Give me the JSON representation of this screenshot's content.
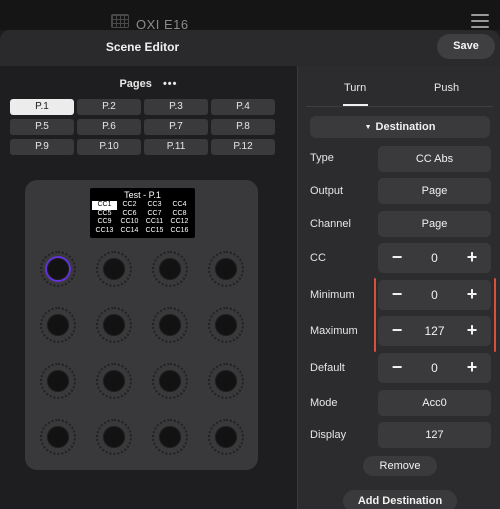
{
  "window": {
    "device_name": "OXI E16",
    "title": "Scene Editor",
    "save_label": "Save"
  },
  "pages": {
    "label": "Pages",
    "more": "•••",
    "items": [
      "P.1",
      "P.2",
      "P.3",
      "P.4",
      "P.5",
      "P.6",
      "P.7",
      "P.8",
      "P.9",
      "P.10",
      "P.11",
      "P.12"
    ],
    "selected": "P.1"
  },
  "device": {
    "screen_title": "Test - P.1",
    "cc_labels": [
      "CC1",
      "CC2",
      "CC3",
      "CC4",
      "CC5",
      "CC6",
      "CC7",
      "CC8",
      "CC9",
      "CC10",
      "CC11",
      "CC12",
      "CC13",
      "CC14",
      "CC15",
      "CC16"
    ],
    "selected_cc": "CC1",
    "active_knob": 1,
    "knob_count": 16,
    "colors": {
      "active_ring": "#6233d6"
    }
  },
  "tabs": {
    "turn": "Turn",
    "push": "Push",
    "active": "Turn"
  },
  "destination": {
    "header": "Destination",
    "type": {
      "label": "Type",
      "value": "CC Abs"
    },
    "output": {
      "label": "Output",
      "value": "Page"
    },
    "channel": {
      "label": "Channel",
      "value": "Page"
    },
    "cc": {
      "label": "CC",
      "value": "0"
    },
    "minimum": {
      "label": "Minimum",
      "value": "0"
    },
    "maximum": {
      "label": "Maximum",
      "value": "127"
    },
    "default": {
      "label": "Default",
      "value": "0"
    },
    "mode": {
      "label": "Mode",
      "value": "Acc0"
    },
    "display": {
      "label": "Display",
      "value": "127"
    },
    "range_color": "#d9513b",
    "stepper_minus": "−",
    "stepper_plus": "+"
  },
  "actions": {
    "remove": "Remove",
    "add_destination": "Add Destination"
  }
}
